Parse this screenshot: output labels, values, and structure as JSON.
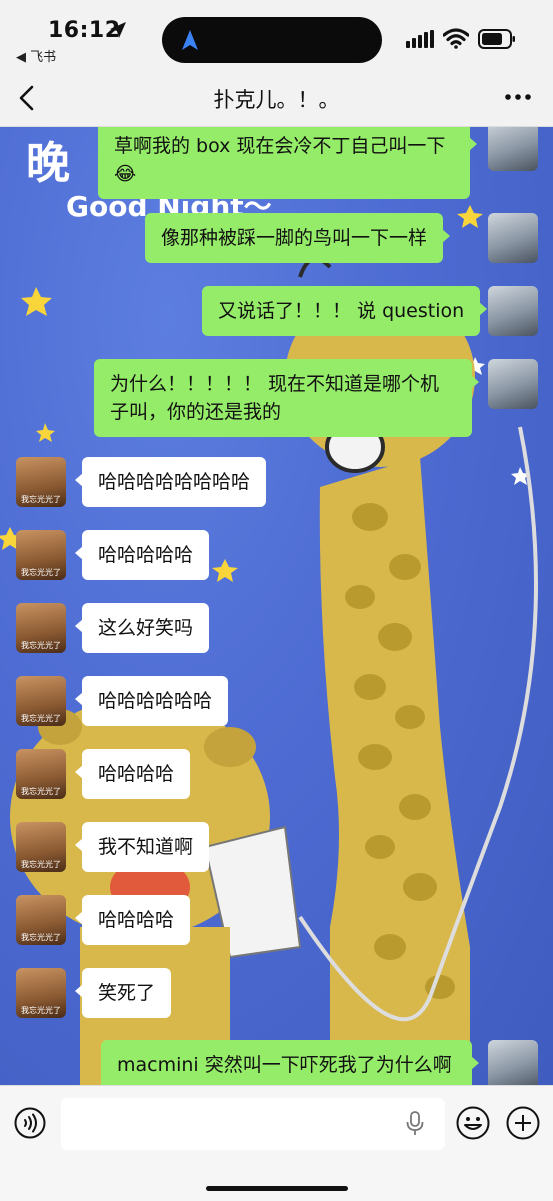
{
  "status_bar": {
    "time": "16:12",
    "back_app": "◀ 飞书"
  },
  "nav": {
    "title": "扑克儿。！。"
  },
  "wallpaper": {
    "text": "Good Night～",
    "big": "晚"
  },
  "messages_right": [
    {
      "text": "草啊我的 box 现在会冷不丁自己叫一下😂"
    },
    {
      "text": "像那种被踩一脚的鸟叫一下一样"
    },
    {
      "text": "又说话了！！！ 说 question"
    },
    {
      "text": "为什么！！！！！ 现在不知道是哪个机子叫，你的还是我的"
    },
    {
      "text": "macmini 突然叫一下吓死我了为什么啊"
    }
  ],
  "messages_left": [
    {
      "text": "哈哈哈哈哈哈哈哈"
    },
    {
      "text": "哈哈哈哈哈"
    },
    {
      "text": "这么好笑吗"
    },
    {
      "text": "哈哈哈哈哈哈"
    },
    {
      "text": "哈哈哈哈"
    },
    {
      "text": "我不知道啊"
    },
    {
      "text": "哈哈哈哈"
    },
    {
      "text": "笑死了"
    }
  ],
  "avatar_caption": "我忘光光了",
  "input": {
    "value": ""
  },
  "colors": {
    "my_bubble": "#95ec69",
    "their_bubble": "#ffffff",
    "wallpaper": "#4d6bd2"
  }
}
